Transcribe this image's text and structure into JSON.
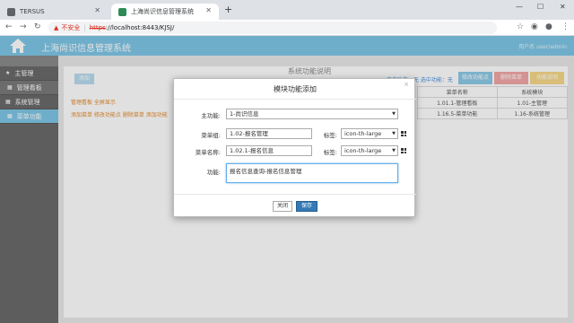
{
  "browser": {
    "tabs": [
      {
        "title": "TERSUS"
      },
      {
        "title": "上海尚识信息管理系统"
      }
    ],
    "address": {
      "security": "不安全",
      "scheme": "https",
      "rest": "://localhost:8443/KJSJ/"
    }
  },
  "app": {
    "title": "上海尚识信息管理系统",
    "user": "用户名 user/admin",
    "brand_color": "#7fc7e6"
  },
  "sidebar": {
    "items": [
      {
        "label": "主管理"
      },
      {
        "label": "管理看板"
      },
      {
        "label": "系统管理"
      },
      {
        "label": "菜单功能"
      }
    ]
  },
  "main": {
    "add_button": "添加",
    "section_title": "系统功能说明",
    "selection_info": "选中功能：无  选中功能：无",
    "toolbar_buttons": [
      "修改功能点",
      "删除菜单",
      "功能说明"
    ],
    "left_links": [
      "管理看板  全屏显示",
      "添加菜单  修改功能点  删除菜单  添加功能"
    ],
    "table": {
      "headers": [
        "菜单名称",
        "系统模块"
      ],
      "rows": [
        [
          "1.01.1-管理看板",
          "1.01-主管理"
        ],
        [
          "1.16.5-菜单功能",
          "1.16-系统管理"
        ]
      ]
    }
  },
  "modal": {
    "title": "模块功能添加",
    "close_symbol": "×",
    "fields": {
      "main_function_label": "主功能:",
      "main_function_value": "1-尚识信息",
      "menu_group_label": "菜单组:",
      "menu_group_value": "1.02-报名管理",
      "menu_group_icon_label": "标签:",
      "menu_group_icon_value": "icon-th-large",
      "menu_name_label": "菜单名称:",
      "menu_name_value": "1.02.1-报名信息",
      "menu_name_icon_label": "标签:",
      "menu_name_icon_value": "icon-th-large",
      "function_label": "功能:",
      "function_value": "报名信息查询-报名信息管理"
    },
    "buttons": {
      "close": "关闭",
      "save": "保存"
    }
  }
}
